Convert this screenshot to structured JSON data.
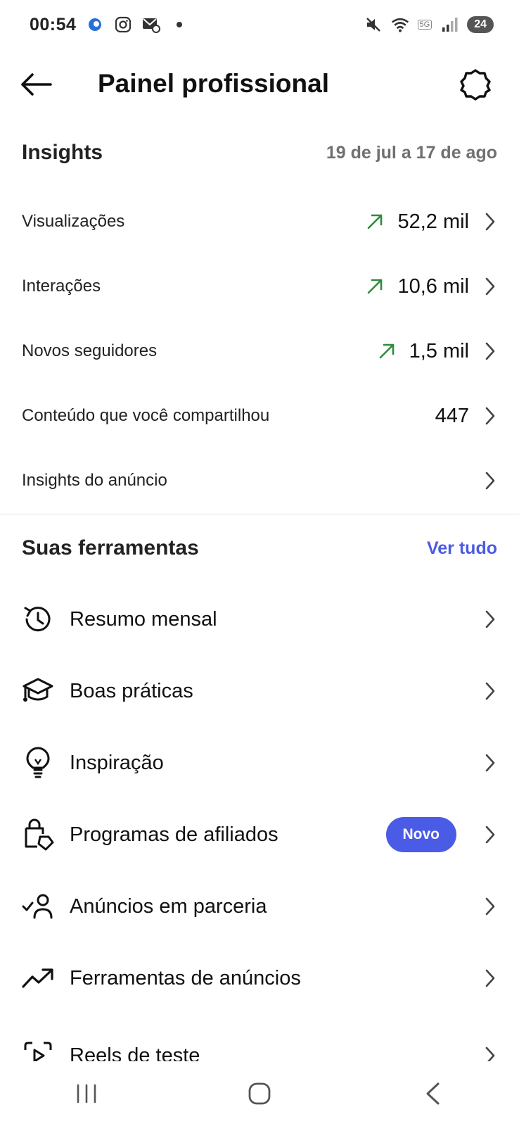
{
  "status": {
    "time": "00:54",
    "battery": "24",
    "net_tag": "5G"
  },
  "header": {
    "title": "Painel profissional"
  },
  "insights": {
    "title": "Insights",
    "date_range": "19 de jul a 17 de ago",
    "rows": [
      {
        "label": "Visualizações",
        "value": "52,2 mil",
        "trend": "up"
      },
      {
        "label": "Interações",
        "value": "10,6 mil",
        "trend": "up"
      },
      {
        "label": "Novos seguidores",
        "value": "1,5 mil",
        "trend": "up"
      },
      {
        "label": "Conteúdo que você compartilhou",
        "value": "447",
        "trend": "none"
      },
      {
        "label": "Insights do anúncio",
        "value": "",
        "trend": "none"
      }
    ]
  },
  "tools": {
    "title": "Suas ferramentas",
    "see_all": "Ver tudo",
    "items": [
      {
        "label": "Resumo mensal",
        "icon": "history-icon"
      },
      {
        "label": "Boas práticas",
        "icon": "graduation-cap-icon"
      },
      {
        "label": "Inspiração",
        "icon": "lightbulb-icon"
      },
      {
        "label": "Programas de afiliados",
        "icon": "shopping-bag-tag-icon",
        "badge": "Novo"
      },
      {
        "label": "Anúncios em parceria",
        "icon": "person-check-icon"
      },
      {
        "label": "Ferramentas de anúncios",
        "icon": "trending-up-icon"
      },
      {
        "label": "Reels de teste",
        "icon": "reels-test-icon"
      }
    ]
  },
  "colors": {
    "accent": "#4a5be6",
    "trend_up": "#2e8b3e",
    "text": "#111111",
    "muted": "#707070"
  }
}
